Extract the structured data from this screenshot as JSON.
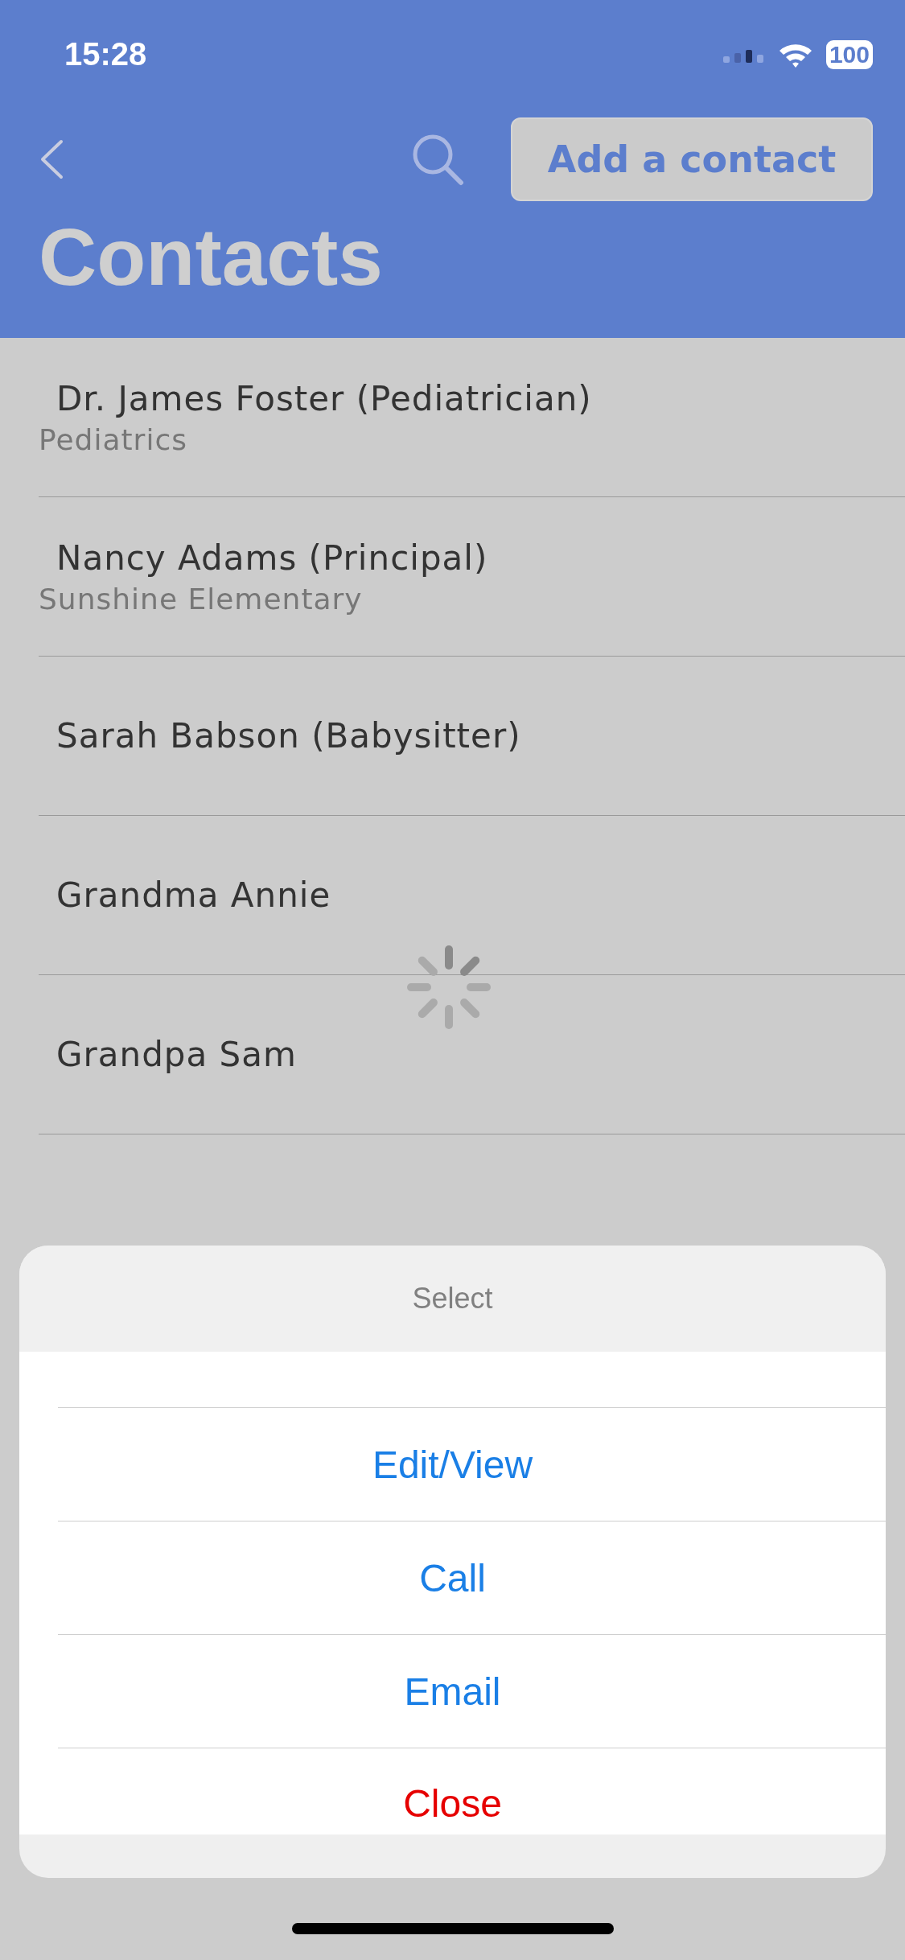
{
  "status_bar": {
    "time": "15:28",
    "battery": "100"
  },
  "nav": {
    "add_button": "Add a contact",
    "title": "Contacts"
  },
  "contacts": [
    {
      "name": "Dr. James Foster (Pediatrician)",
      "subtitle": "Pediatrics"
    },
    {
      "name": "Nancy Adams (Principal)",
      "subtitle": "Sunshine Elementary"
    },
    {
      "name": "Sarah Babson (Babysitter)"
    },
    {
      "name": "Grandma Annie"
    },
    {
      "name": "Grandpa Sam"
    }
  ],
  "action_sheet": {
    "title": "Select",
    "actions": [
      {
        "label": "Edit/View",
        "kind": "default"
      },
      {
        "label": "Call",
        "kind": "default"
      },
      {
        "label": "Email",
        "kind": "default"
      },
      {
        "label": "Close",
        "kind": "destructive"
      }
    ]
  }
}
